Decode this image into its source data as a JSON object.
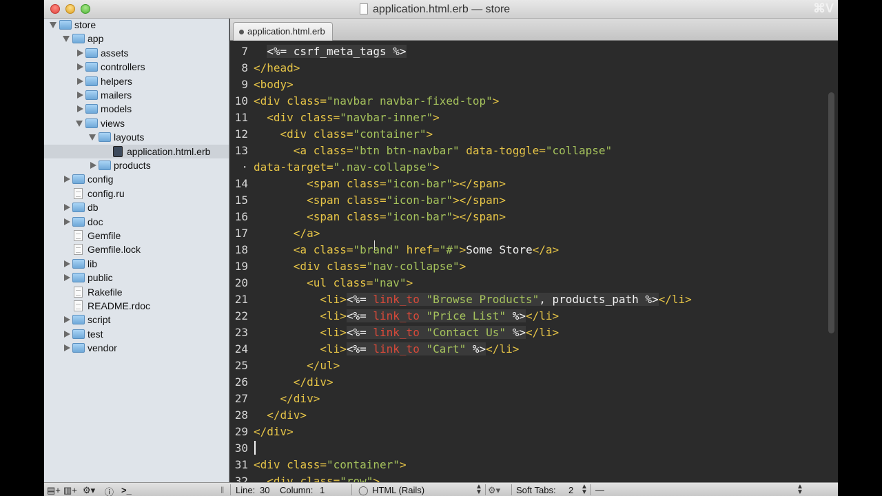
{
  "window": {
    "title": "application.html.erb — store",
    "shortcut": "⌘V"
  },
  "tab": {
    "label": "application.html.erb"
  },
  "tree": [
    {
      "label": "store",
      "type": "folder",
      "depth": 0,
      "expanded": true
    },
    {
      "label": "app",
      "type": "folder",
      "depth": 1,
      "expanded": true
    },
    {
      "label": "assets",
      "type": "folder",
      "depth": 2,
      "expanded": false
    },
    {
      "label": "controllers",
      "type": "folder",
      "depth": 2,
      "expanded": false
    },
    {
      "label": "helpers",
      "type": "folder",
      "depth": 2,
      "expanded": false
    },
    {
      "label": "mailers",
      "type": "folder",
      "depth": 2,
      "expanded": false
    },
    {
      "label": "models",
      "type": "folder",
      "depth": 2,
      "expanded": false
    },
    {
      "label": "views",
      "type": "folder",
      "depth": 2,
      "expanded": true
    },
    {
      "label": "layouts",
      "type": "folder",
      "depth": 3,
      "expanded": true
    },
    {
      "label": "application.html.erb",
      "type": "erb",
      "depth": 4,
      "selected": true
    },
    {
      "label": "products",
      "type": "folder",
      "depth": 3,
      "expanded": false
    },
    {
      "label": "config",
      "type": "folder",
      "depth": 1,
      "expanded": false
    },
    {
      "label": "config.ru",
      "type": "file",
      "depth": 1
    },
    {
      "label": "db",
      "type": "folder",
      "depth": 1,
      "expanded": false
    },
    {
      "label": "doc",
      "type": "folder",
      "depth": 1,
      "expanded": false
    },
    {
      "label": "Gemfile",
      "type": "file",
      "depth": 1
    },
    {
      "label": "Gemfile.lock",
      "type": "file",
      "depth": 1
    },
    {
      "label": "lib",
      "type": "folder",
      "depth": 1,
      "expanded": false
    },
    {
      "label": "public",
      "type": "folder",
      "depth": 1,
      "expanded": false
    },
    {
      "label": "Rakefile",
      "type": "file",
      "depth": 1
    },
    {
      "label": "README.rdoc",
      "type": "file",
      "depth": 1
    },
    {
      "label": "script",
      "type": "folder",
      "depth": 1,
      "expanded": false
    },
    {
      "label": "test",
      "type": "folder",
      "depth": 1,
      "expanded": false
    },
    {
      "label": "vendor",
      "type": "folder",
      "depth": 1,
      "expanded": false
    }
  ],
  "editor": {
    "cursor_line": "30",
    "lines": [
      {
        "no": "7",
        "segments": [
          {
            "t": "  ",
            "c": "text"
          },
          {
            "t": "<%= csrf_meta_tags %>",
            "c": "erb",
            "bg": true
          }
        ]
      },
      {
        "no": "8",
        "segments": [
          {
            "t": "</head>",
            "c": "tag"
          }
        ]
      },
      {
        "no": "9",
        "segments": [
          {
            "t": "<body>",
            "c": "tag"
          }
        ]
      },
      {
        "no": "10",
        "segments": [
          {
            "t": "<div ",
            "c": "tag"
          },
          {
            "t": "class=",
            "c": "attr"
          },
          {
            "t": "\"navbar navbar-fixed-top\"",
            "c": "str"
          },
          {
            "t": ">",
            "c": "tag"
          }
        ]
      },
      {
        "no": "11",
        "segments": [
          {
            "t": "  <div ",
            "c": "tag"
          },
          {
            "t": "class=",
            "c": "attr"
          },
          {
            "t": "\"navbar-inner\"",
            "c": "str"
          },
          {
            "t": ">",
            "c": "tag"
          }
        ]
      },
      {
        "no": "12",
        "segments": [
          {
            "t": "    <div ",
            "c": "tag"
          },
          {
            "t": "class=",
            "c": "attr"
          },
          {
            "t": "\"container\"",
            "c": "str"
          },
          {
            "t": ">",
            "c": "tag"
          }
        ]
      },
      {
        "no": "13",
        "segments": [
          {
            "t": "      <a ",
            "c": "tag"
          },
          {
            "t": "class=",
            "c": "attr"
          },
          {
            "t": "\"btn btn-navbar\"",
            "c": "str"
          },
          {
            "t": " data-toggle=",
            "c": "attr"
          },
          {
            "t": "\"collapse\"",
            "c": "str"
          }
        ]
      },
      {
        "no": "·",
        "segments": [
          {
            "t": "data-target=",
            "c": "attr"
          },
          {
            "t": "\".nav-collapse\"",
            "c": "str"
          },
          {
            "t": ">",
            "c": "tag"
          }
        ]
      },
      {
        "no": "14",
        "segments": [
          {
            "t": "        <span ",
            "c": "tag"
          },
          {
            "t": "class=",
            "c": "attr"
          },
          {
            "t": "\"icon-bar\"",
            "c": "str"
          },
          {
            "t": "></span>",
            "c": "tag"
          }
        ]
      },
      {
        "no": "15",
        "segments": [
          {
            "t": "        <span ",
            "c": "tag"
          },
          {
            "t": "class=",
            "c": "attr"
          },
          {
            "t": "\"icon-bar\"",
            "c": "str"
          },
          {
            "t": "></span>",
            "c": "tag"
          }
        ]
      },
      {
        "no": "16",
        "segments": [
          {
            "t": "        <span ",
            "c": "tag"
          },
          {
            "t": "class=",
            "c": "attr"
          },
          {
            "t": "\"icon-bar\"",
            "c": "str"
          },
          {
            "t": "></span>",
            "c": "tag"
          }
        ]
      },
      {
        "no": "17",
        "segments": [
          {
            "t": "      </a>",
            "c": "tag"
          }
        ]
      },
      {
        "no": "18",
        "segments": [
          {
            "t": "      <a ",
            "c": "tag"
          },
          {
            "t": "class=",
            "c": "attr"
          },
          {
            "t": "\"brand\"",
            "c": "str"
          },
          {
            "t": " href=",
            "c": "attr"
          },
          {
            "t": "\"#\"",
            "c": "str"
          },
          {
            "t": ">",
            "c": "tag"
          },
          {
            "t": "Some Store",
            "c": "text"
          },
          {
            "t": "</a>",
            "c": "tag"
          }
        ]
      },
      {
        "no": "19",
        "segments": [
          {
            "t": "      <div ",
            "c": "tag"
          },
          {
            "t": "class=",
            "c": "attr"
          },
          {
            "t": "\"nav-collapse\"",
            "c": "str"
          },
          {
            "t": ">",
            "c": "tag"
          }
        ]
      },
      {
        "no": "20",
        "segments": [
          {
            "t": "        <ul ",
            "c": "tag"
          },
          {
            "t": "class=",
            "c": "attr"
          },
          {
            "t": "\"nav\"",
            "c": "str"
          },
          {
            "t": ">",
            "c": "tag"
          }
        ]
      },
      {
        "no": "21",
        "segments": [
          {
            "t": "          <li>",
            "c": "tag"
          },
          {
            "t": "<%= ",
            "c": "erb",
            "bg": true
          },
          {
            "t": "link_to",
            "c": "red",
            "bg": true
          },
          {
            "t": " ",
            "c": "erb",
            "bg": true
          },
          {
            "t": "\"Browse Products\"",
            "c": "str",
            "bg": true
          },
          {
            "t": ", products_path %>",
            "c": "erb",
            "bg": true
          },
          {
            "t": "</li>",
            "c": "tag"
          }
        ]
      },
      {
        "no": "22",
        "segments": [
          {
            "t": "          <li>",
            "c": "tag"
          },
          {
            "t": "<%= ",
            "c": "erb",
            "bg": true
          },
          {
            "t": "link_to",
            "c": "red",
            "bg": true
          },
          {
            "t": " ",
            "c": "erb",
            "bg": true
          },
          {
            "t": "\"Price List\"",
            "c": "str",
            "bg": true
          },
          {
            "t": " %>",
            "c": "erb",
            "bg": true
          },
          {
            "t": "</li>",
            "c": "tag"
          }
        ]
      },
      {
        "no": "23",
        "segments": [
          {
            "t": "          <li>",
            "c": "tag"
          },
          {
            "t": "<%= ",
            "c": "erb",
            "bg": true
          },
          {
            "t": "link_to",
            "c": "red",
            "bg": true
          },
          {
            "t": " ",
            "c": "erb",
            "bg": true
          },
          {
            "t": "\"Contact Us\"",
            "c": "str",
            "bg": true
          },
          {
            "t": " %>",
            "c": "erb",
            "bg": true
          },
          {
            "t": "</li>",
            "c": "tag"
          }
        ]
      },
      {
        "no": "24",
        "segments": [
          {
            "t": "          <li>",
            "c": "tag"
          },
          {
            "t": "<%= ",
            "c": "erb",
            "bg": true
          },
          {
            "t": "link_to",
            "c": "red",
            "bg": true
          },
          {
            "t": " ",
            "c": "erb",
            "bg": true
          },
          {
            "t": "\"Cart\"",
            "c": "str",
            "bg": true
          },
          {
            "t": " %>",
            "c": "erb",
            "bg": true
          },
          {
            "t": "</li>",
            "c": "tag"
          }
        ]
      },
      {
        "no": "25",
        "segments": [
          {
            "t": "        </ul>",
            "c": "tag"
          }
        ]
      },
      {
        "no": "26",
        "segments": [
          {
            "t": "      </div>",
            "c": "tag"
          }
        ]
      },
      {
        "no": "27",
        "segments": [
          {
            "t": "    </div>",
            "c": "tag"
          }
        ]
      },
      {
        "no": "28",
        "segments": [
          {
            "t": "  </div>",
            "c": "tag"
          }
        ]
      },
      {
        "no": "29",
        "segments": [
          {
            "t": "</div>",
            "c": "tag"
          }
        ]
      },
      {
        "no": "30",
        "segments": []
      },
      {
        "no": "31",
        "segments": [
          {
            "t": "<div ",
            "c": "tag"
          },
          {
            "t": "class=",
            "c": "attr"
          },
          {
            "t": "\"container\"",
            "c": "str"
          },
          {
            "t": ">",
            "c": "tag"
          }
        ]
      },
      {
        "no": "32",
        "segments": [
          {
            "t": "  <div ",
            "c": "tag"
          },
          {
            "t": "class=",
            "c": "attr"
          },
          {
            "t": "\"row\"",
            "c": "str"
          },
          {
            "t": ">",
            "c": "tag"
          }
        ]
      }
    ]
  },
  "status": {
    "line_label": "Line:",
    "line_value": "30",
    "column_label": "Column:",
    "column_value": "1",
    "syntax": "HTML (Rails)",
    "soft_tabs_label": "Soft Tabs:",
    "soft_tabs_value": "2",
    "symbol": "—"
  }
}
